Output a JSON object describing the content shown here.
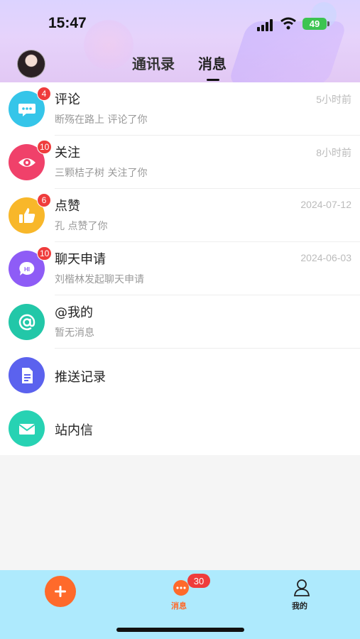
{
  "status_bar": {
    "time": "15:47",
    "battery": "49"
  },
  "header": {
    "tabs": [
      "通讯录",
      "消息"
    ],
    "active_tab": "消息"
  },
  "messages": [
    {
      "title": "评论",
      "subtitle": "断殇在路上 评论了你",
      "time": "5小时前",
      "badge": "4",
      "icon": "comment-bubble-icon",
      "color": "#35c5e9"
    },
    {
      "title": "关注",
      "subtitle": "三颗桔子树 关注了你",
      "time": "8小时前",
      "badge": "10",
      "icon": "eye-icon",
      "color": "#f0416a"
    },
    {
      "title": "点赞",
      "subtitle": "孔 点赞了你",
      "time": "2024-07-12",
      "badge": "6",
      "icon": "thumbs-up-icon",
      "color": "#f8b72a"
    },
    {
      "title": "聊天申请",
      "subtitle": "刘楷林发起聊天申请",
      "time": "2024-06-03",
      "badge": "10",
      "icon": "hi-chat-icon",
      "color": "#8e5cf6"
    },
    {
      "title": "@我的",
      "subtitle": "暂无消息",
      "time": "",
      "badge": "",
      "icon": "at-icon",
      "color": "#22c7a8"
    },
    {
      "title": "推送记录",
      "subtitle": "",
      "time": "",
      "badge": "",
      "icon": "document-icon",
      "color": "#5b62ee"
    },
    {
      "title": "站内信",
      "subtitle": "",
      "time": "",
      "badge": "",
      "icon": "mail-icon",
      "color": "#27d2b3"
    }
  ],
  "tabbar": {
    "messages_label": "消息",
    "messages_badge": "30",
    "me_label": "我的"
  },
  "colors": {
    "accent": "#ff6a2b",
    "badge": "#ef3c3c",
    "tabbar_bg": "#aeeafd"
  }
}
